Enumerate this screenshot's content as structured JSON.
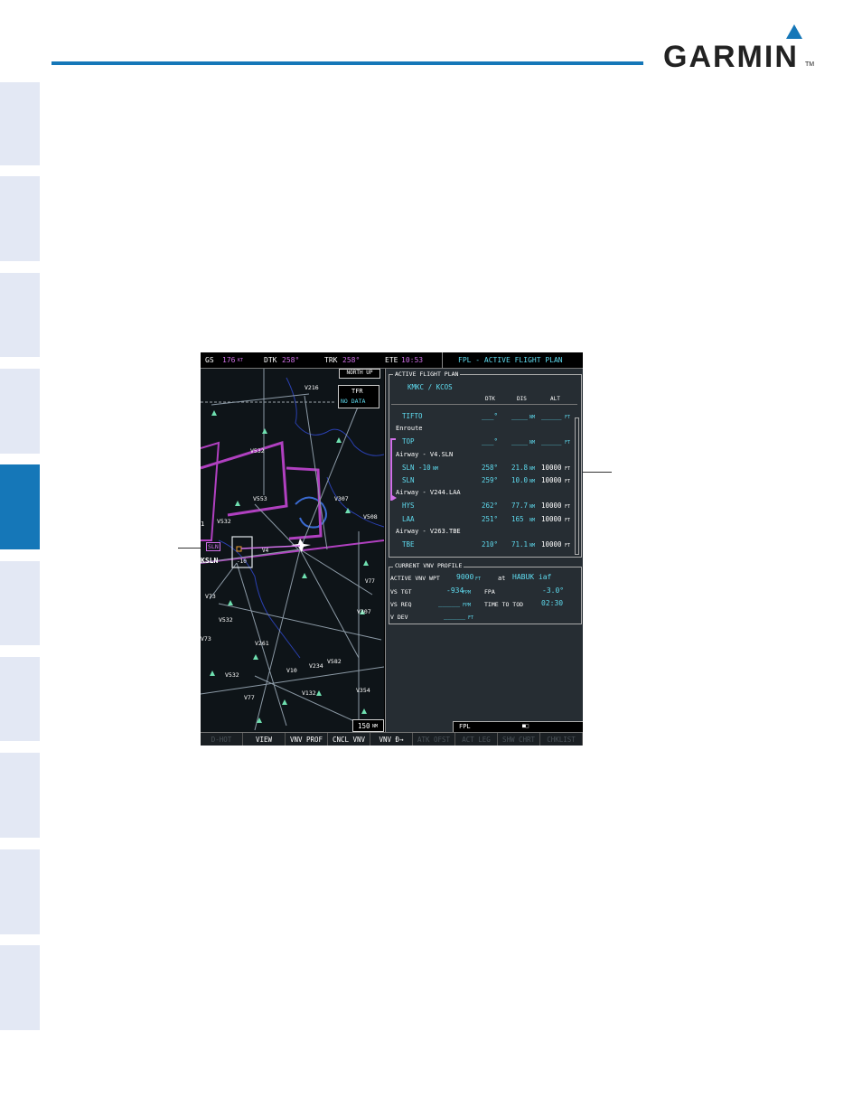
{
  "brand": {
    "name": "GARMIN",
    "tm": "TM"
  },
  "status_bar": {
    "gs_label": "GS",
    "gs_value": "176",
    "gs_unit": "KT",
    "dtk_label": "DTK",
    "dtk_value": "258°",
    "trk_label": "TRK",
    "trk_value": "258°",
    "ete_label": "ETE",
    "ete_value": "10:53",
    "page_title": "FPL - ACTIVE FLIGHT PLAN"
  },
  "map": {
    "orientation": "NORTH UP",
    "tfr_label": "TFR",
    "tfr_status": "NO DATA",
    "range": "150",
    "range_unit": "NM",
    "airways": [
      "V216",
      "V532",
      "V553",
      "V307",
      "V508",
      "V532",
      "V4",
      "V77",
      "V73",
      "V532",
      "V307",
      "V73",
      "V261",
      "V582",
      "V10",
      "V234",
      "V532",
      "V77",
      "V132",
      "V354"
    ],
    "waypoint_labels": {
      "sln": "SLN",
      "ksln": "KSLN",
      "offset": "-10",
      "vor": "1"
    }
  },
  "flight_plan": {
    "box_title": "ACTIVE FLIGHT PLAN",
    "route": "KMKC / KCOS",
    "headers": {
      "dtk": "DTK",
      "dis": "DIS",
      "alt": "ALT"
    },
    "rows": [
      {
        "name": "TIFTO",
        "dtk": "___°",
        "dis": "____",
        "dis_unit": "NM",
        "alt": "_____",
        "alt_unit": "FT",
        "kind": "wpt"
      },
      {
        "name": "Enroute",
        "kind": "header"
      },
      {
        "name": "TOP",
        "dtk": "___°",
        "dis": "____",
        "dis_unit": "NM",
        "alt": "_____",
        "alt_unit": "FT",
        "kind": "wpt"
      },
      {
        "name": "Airway - V4.SLN",
        "kind": "header"
      },
      {
        "name": "SLN -10",
        "name_unit": "NM",
        "dtk": "258°",
        "dis": "21.8",
        "dis_unit": "NM",
        "alt": "10000",
        "alt_unit": "FT",
        "kind": "wpt"
      },
      {
        "name": "SLN",
        "dtk": "259°",
        "dis": "10.0",
        "dis_unit": "NM",
        "alt": "10000",
        "alt_unit": "FT",
        "kind": "wpt"
      },
      {
        "name": "Airway - V244.LAA",
        "kind": "header"
      },
      {
        "name": "HYS",
        "dtk": "262°",
        "dis": "77.7",
        "dis_unit": "NM",
        "alt": "10000",
        "alt_unit": "FT",
        "kind": "wpt"
      },
      {
        "name": "LAA",
        "dtk": "251°",
        "dis": "165",
        "dis_unit": "NM",
        "alt": "10000",
        "alt_unit": "FT",
        "kind": "wpt"
      },
      {
        "name": "Airway - V263.TBE",
        "kind": "header"
      },
      {
        "name": "TBE",
        "dtk": "210°",
        "dis": "71.1",
        "dis_unit": "NM",
        "alt": "10000",
        "alt_unit": "FT",
        "kind": "wpt"
      }
    ]
  },
  "vnv_profile": {
    "box_title": "CURRENT VNV PROFILE",
    "active_wpt_label": "ACTIVE VNV WPT",
    "active_wpt_alt": "9000",
    "active_wpt_alt_unit": "FT",
    "at_label": "at",
    "active_wpt_name": "HABUK iaf",
    "vs_tgt_label": "VS TGT",
    "vs_tgt_value": "-934",
    "vs_tgt_unit": "FPM",
    "fpa_label": "FPA",
    "fpa_value": "-3.0°",
    "vs_req_label": "VS REQ",
    "vs_req_value": "_____",
    "vs_req_unit": "FPM",
    "tod_label": "TIME TO TOD",
    "tod_value": "02:30",
    "vdev_label": "V DEV",
    "vdev_value": "_____",
    "vdev_unit": "FT"
  },
  "fpl_indicator": {
    "label": "FPL",
    "pages": "■□"
  },
  "softkeys": [
    {
      "label": "D-HOT",
      "enabled": false
    },
    {
      "label": "VIEW",
      "enabled": true
    },
    {
      "label": "VNV PROF",
      "enabled": true
    },
    {
      "label": "CNCL VNV",
      "enabled": true
    },
    {
      "label": "VNV Đ→",
      "enabled": true
    },
    {
      "label": "ATK OFST",
      "enabled": false
    },
    {
      "label": "ACT LEG",
      "enabled": false
    },
    {
      "label": "SHW CHRT",
      "enabled": false
    },
    {
      "label": "CHKLIST",
      "enabled": false
    }
  ],
  "colors": {
    "accent": "#1577b8",
    "tab": "#e3e8f4",
    "cyan": "#5fdcf0",
    "magenta": "#d070e8",
    "map_bg": "#0e1418"
  }
}
